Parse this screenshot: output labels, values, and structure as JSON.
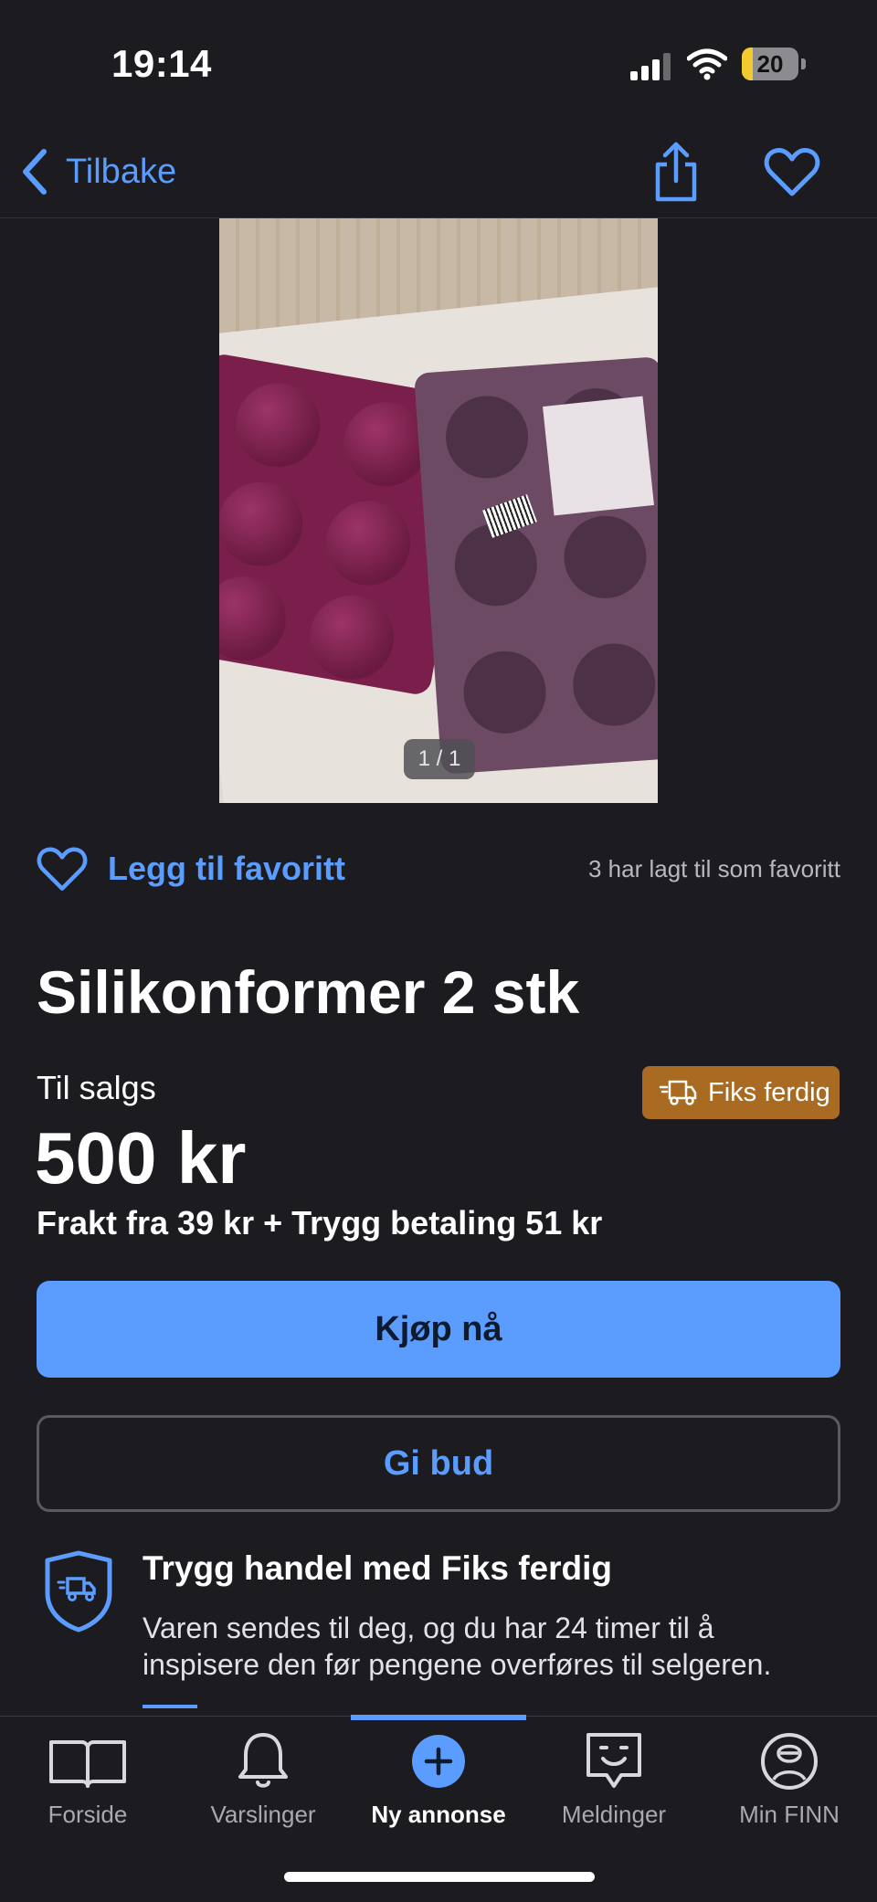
{
  "status_bar": {
    "time": "19:14",
    "battery": "20",
    "battery_level": 0.2
  },
  "nav": {
    "back_label": "Tilbake"
  },
  "gallery": {
    "counter": "1 / 1"
  },
  "favorite": {
    "label": "Legg til favoritt",
    "count_text": "3 har lagt til som favoritt"
  },
  "listing": {
    "title": "Silikonformer 2 stk",
    "category": "Til salgs",
    "badge": "Fiks ferdig",
    "price": "500 kr",
    "shipping": "Frakt fra 39 kr + Trygg betaling 51 kr"
  },
  "actions": {
    "buy_label": "Kjøp nå",
    "bid_label": "Gi bud"
  },
  "safe_trade": {
    "heading": "Trygg handel med Fiks ferdig",
    "body": "Varen sendes til deg, og du har 24 timer til å inspisere den før pengene overføres til selgeren."
  },
  "tabbar": {
    "items": [
      {
        "label": "Forside",
        "icon": "book-icon"
      },
      {
        "label": "Varslinger",
        "icon": "bell-icon"
      },
      {
        "label": "Ny annonse",
        "icon": "plus-icon",
        "active": true
      },
      {
        "label": "Meldinger",
        "icon": "chat-icon"
      },
      {
        "label": "Min FINN",
        "icon": "profile-icon"
      }
    ]
  },
  "colors": {
    "background": "#1c1b20",
    "accent": "#5b9cff",
    "badge": "#a86b21"
  }
}
